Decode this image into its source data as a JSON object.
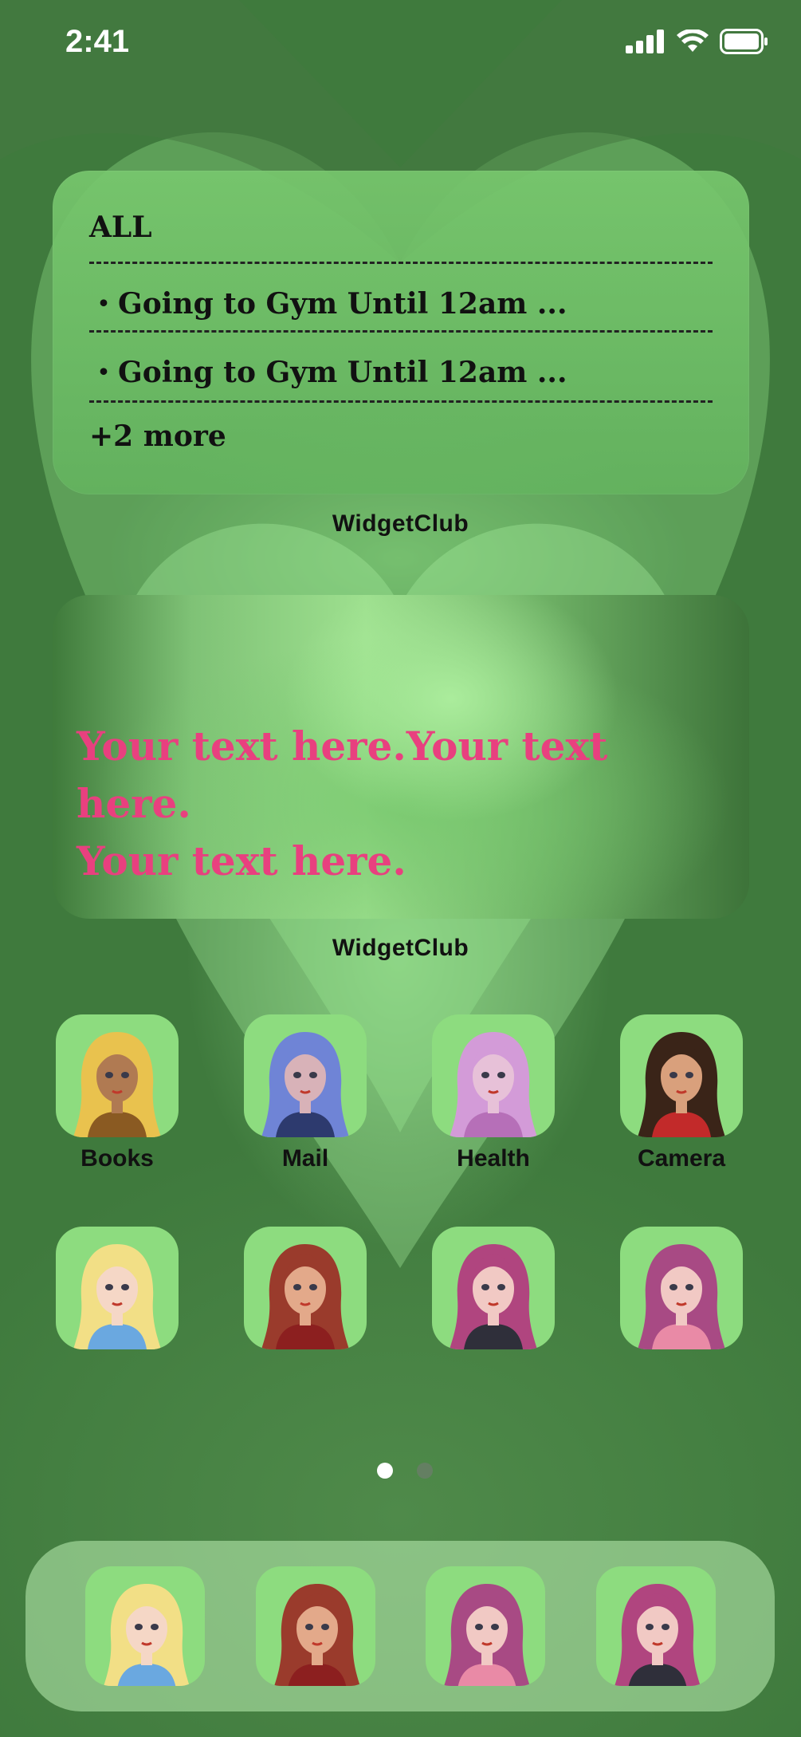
{
  "status_bar": {
    "time": "2:41",
    "icons": [
      "signal-icon",
      "wifi-icon",
      "battery-icon"
    ]
  },
  "todo_widget": {
    "header": "ALL",
    "items": [
      "・Going to Gym Until 12am ...",
      "・Going to Gym Until 12am ..."
    ],
    "more": "+2 more",
    "caption": "WidgetClub"
  },
  "photo_widget": {
    "text_line1": "Your text here.Your text here.",
    "text_line2": "Your text here.",
    "caption": "WidgetClub",
    "text_color": "#e8407f"
  },
  "apps_row1": [
    {
      "label": "Books",
      "hair": "#e9c24e",
      "skin": "#b07a52",
      "shirt": "#8a5a22"
    },
    {
      "label": "Mail",
      "hair": "#6f84d6",
      "skin": "#d8b2b8",
      "shirt": "#2d3a6e"
    },
    {
      "label": "Health",
      "hair": "#d39bd8",
      "skin": "#e7c1d8",
      "shirt": "#b66fb8"
    },
    {
      "label": "Camera",
      "hair": "#3a2418",
      "skin": "#d9a07c",
      "shirt": "#c22a2a"
    }
  ],
  "apps_row2": [
    {
      "label": "",
      "hair": "#f2df86",
      "skin": "#f5d7c6",
      "shirt": "#6aa8e0"
    },
    {
      "label": "",
      "hair": "#9a3b2c",
      "skin": "#e3a98a",
      "shirt": "#8c1f1f"
    },
    {
      "label": "",
      "hair": "#b0457f",
      "skin": "#f1c9c4",
      "shirt": "#2f2f3a"
    },
    {
      "label": "",
      "hair": "#a84a84",
      "skin": "#f1c9c4",
      "shirt": "#e98aa6"
    }
  ],
  "dock_apps": [
    {
      "hair": "#f2df86",
      "skin": "#f5d7c6",
      "shirt": "#6aa8e0"
    },
    {
      "hair": "#9a3b2c",
      "skin": "#e3a98a",
      "shirt": "#8c1f1f"
    },
    {
      "hair": "#a84a84",
      "skin": "#f1c9c4",
      "shirt": "#e98aa6"
    },
    {
      "hair": "#b0457f",
      "skin": "#f1c9c4",
      "shirt": "#2f2f3a"
    }
  ],
  "page_indicator": {
    "current": 1,
    "total": 2
  }
}
